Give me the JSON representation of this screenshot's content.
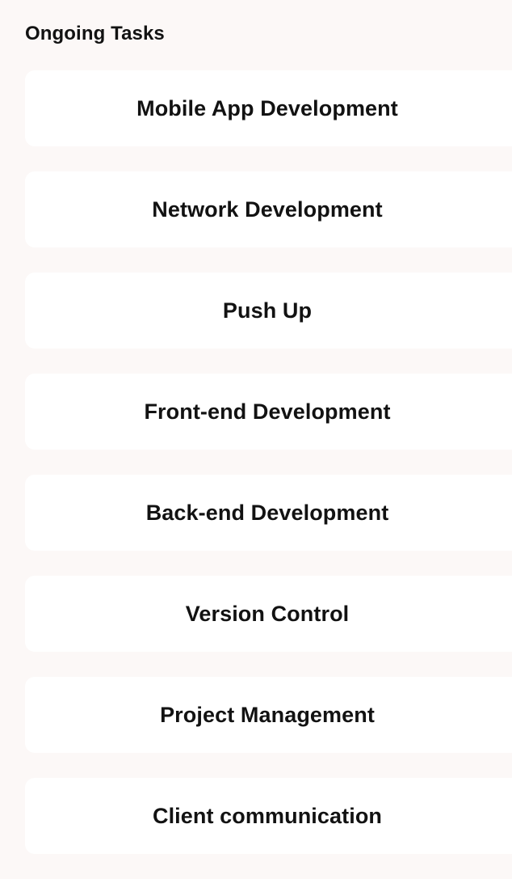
{
  "header": {
    "title": "Ongoing Tasks"
  },
  "tasks": [
    {
      "label": "Mobile App Development"
    },
    {
      "label": "Network Development"
    },
    {
      "label": "Push Up"
    },
    {
      "label": "Front-end Development"
    },
    {
      "label": "Back-end Development"
    },
    {
      "label": "Version Control"
    },
    {
      "label": "Project Management"
    },
    {
      "label": "Client communication"
    }
  ]
}
